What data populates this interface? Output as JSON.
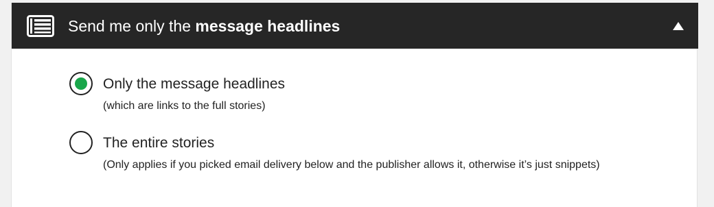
{
  "header": {
    "title_prefix": "Send me only the ",
    "title_bold": "message headlines",
    "list_icon": "list-icon",
    "collapse_icon": "triangle-up-icon"
  },
  "options": [
    {
      "label": "Only the message headlines",
      "sublabel": "(which are links to the full stories)",
      "selected": true
    },
    {
      "label": "The entire stories",
      "sublabel": "(Only applies if you picked email delivery below and the publisher allows it, otherwise it’s just snippets)",
      "selected": false
    }
  ],
  "colors": {
    "header_bg": "#262626",
    "selected_radio": "#19a64a"
  }
}
